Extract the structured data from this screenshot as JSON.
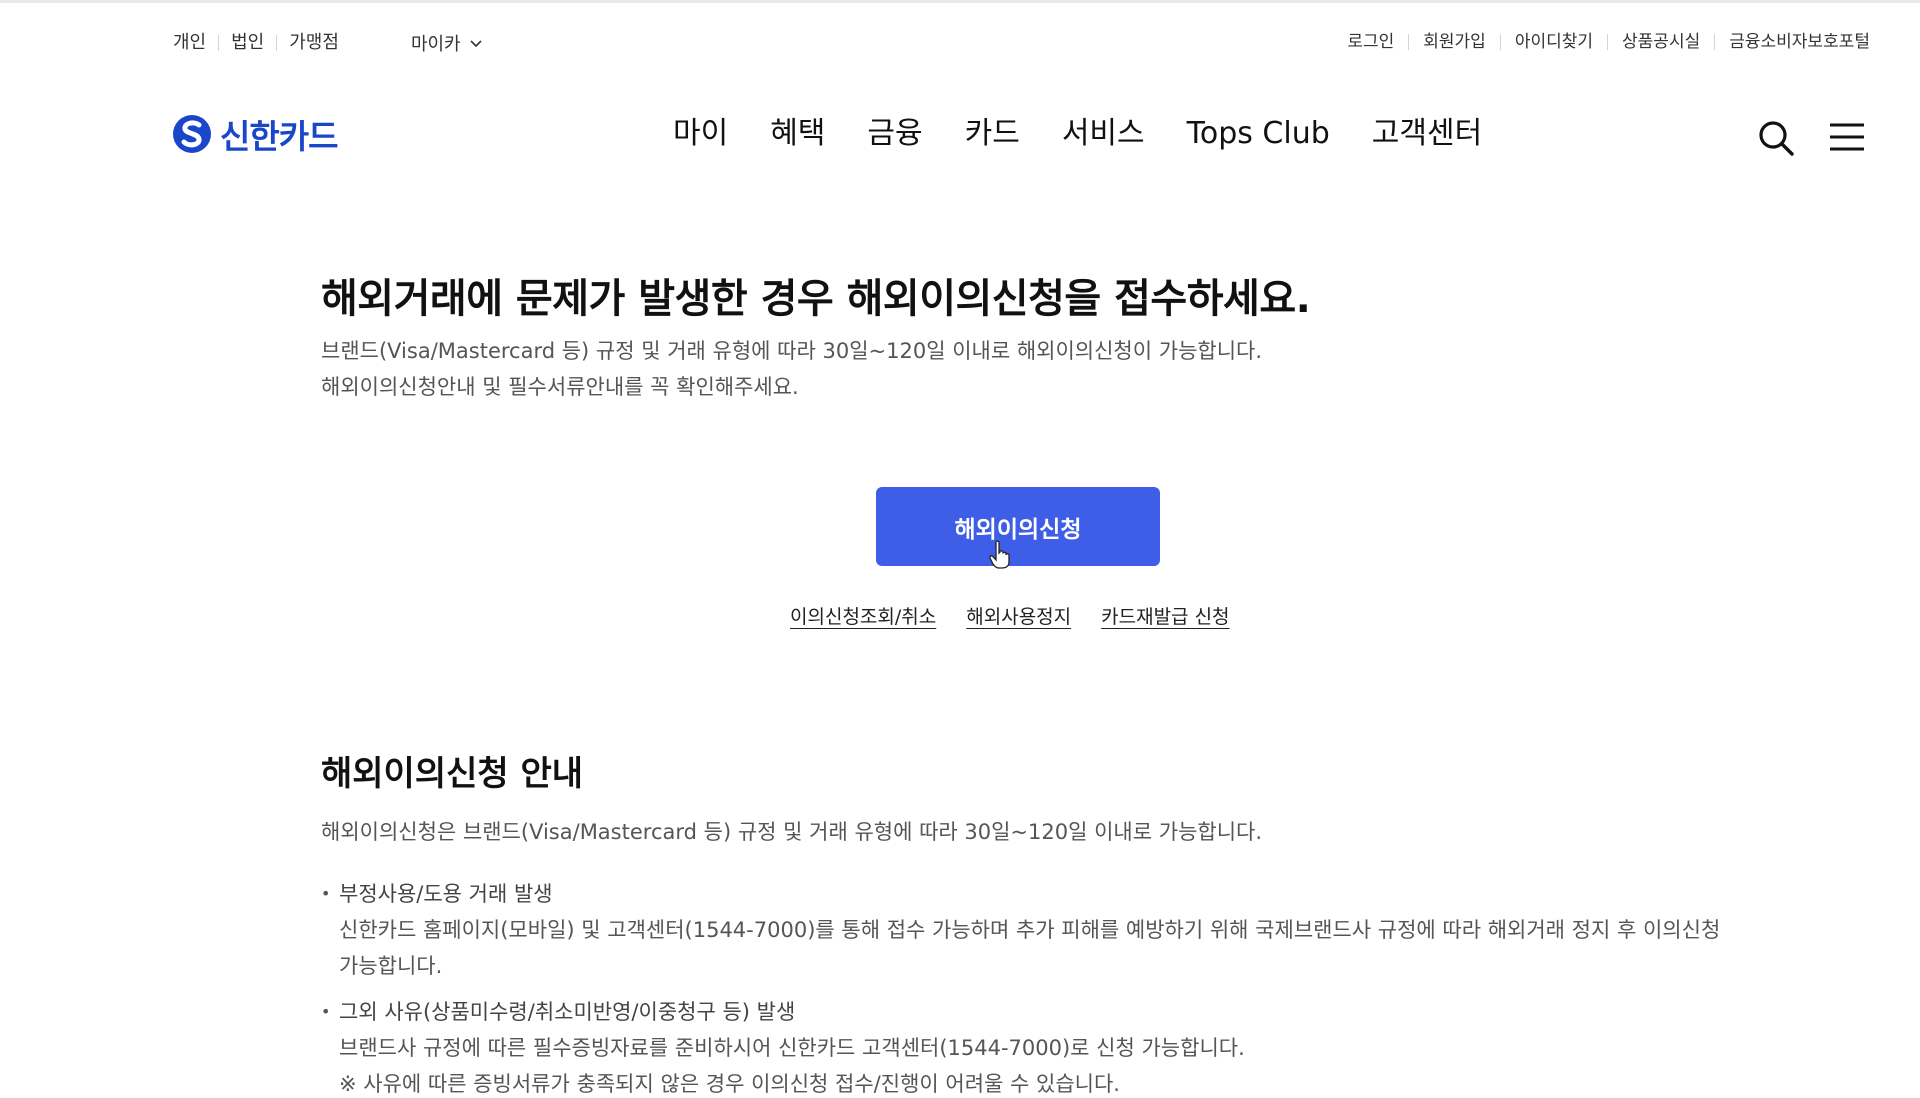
{
  "utility_left": {
    "items": [
      "개인",
      "법인",
      "가맹점"
    ],
    "myca": "마이카"
  },
  "utility_right": {
    "items": [
      "로그인",
      "회원가입",
      "아이디찾기",
      "상품공시실",
      "금융소비자보호포털"
    ]
  },
  "header": {
    "logo_text": "신한카드",
    "nav": [
      "마이",
      "혜택",
      "금융",
      "카드",
      "서비스",
      "Tops Club",
      "고객센터"
    ]
  },
  "hero": {
    "title": "해외거래에 문제가 발생한 경우 해외이의신청을 접수하세요.",
    "desc_line1": "브랜드(Visa/Mastercard 등) 규정 및 거래 유형에 따라 30일~120일 이내로 해외이의신청이 가능합니다.",
    "desc_line2": "해외이의신청안내 및 필수서류안내를 꼭 확인해주세요.",
    "apply_button": "해외이의신청",
    "links": [
      "이의신청조회/취소",
      "해외사용정지",
      "카드재발급 신청"
    ]
  },
  "guide": {
    "title": "해외이의신청 안내",
    "desc": "해외이의신청은 브랜드(Visa/Mastercard 등) 규정 및 거래 유형에 따라 30일~120일 이내로 가능합니다.",
    "items": [
      {
        "title": "부정사용/도용 거래 발생",
        "body": "신한카드 홈페이지(모바일) 및 고객센터(1544-7000)를 통해 접수 가능하며 추가 피해를 예방하기 위해 국제브랜드사 규정에 따라 해외거래 정지 후 이의신청 가능합니다."
      },
      {
        "title": "그외 사유(상품미수령/취소미반영/이중청구 등) 발생",
        "body": "브랜드사 규정에 따른 필수증빙자료를 준비하시어 신한카드 고객센터(1544-7000)로 신청 가능합니다."
      }
    ],
    "cut_note": "※ 사유에 따른 증빙서류가 충족되지 않은 경우 이의신청 접수/진행이 어려울 수 있습니다."
  },
  "colors": {
    "brand_blue": "#1a46c9",
    "button_blue": "#3e5ee8",
    "text_dark": "#111111",
    "text_gray": "#555555"
  },
  "icons": {
    "myca_dropdown": "chevron-down-icon",
    "search": "search-icon",
    "menu": "hamburger-menu-icon",
    "logo": "shinhan-logo-icon",
    "cursor": "hand-pointer-cursor-icon"
  }
}
